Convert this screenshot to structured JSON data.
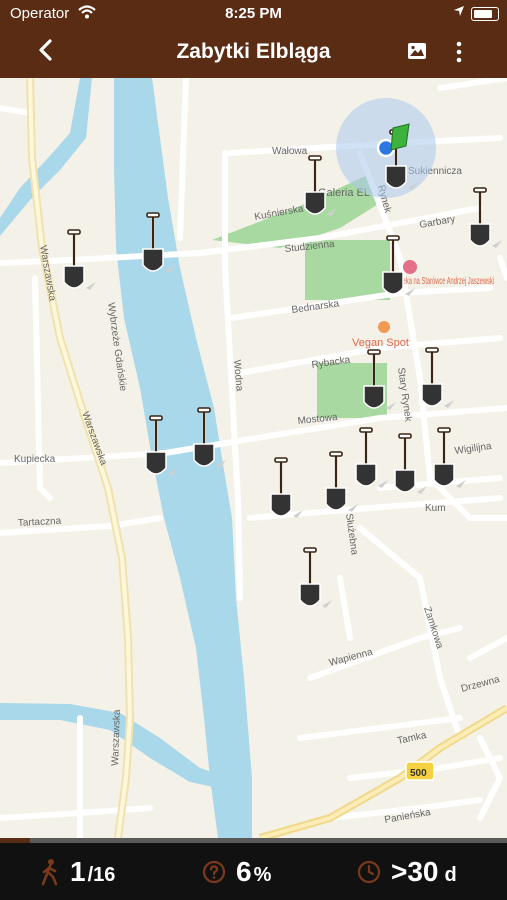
{
  "status_bar": {
    "carrier": "Operator",
    "time": "8:25 PM"
  },
  "nav": {
    "title": "Zabytki Elbląga"
  },
  "map": {
    "streets": {
      "walowa": "Wałowa",
      "sukiennicza": "Sukiennicza",
      "kusnierska": "Kuśnierska",
      "garbary": "Garbary",
      "studzienna": "Studzienna",
      "bednarska": "Bednarska",
      "rybacka": "Rybacka",
      "mostowa": "Mostowa",
      "wigilijna": "Wigilijna",
      "kupiecka": "Kupiecka",
      "tartaczna": "Tartaczna",
      "warszawska_top": "Warszawska",
      "warszawska_mid": "Warszawska",
      "warszawska_bottom": "Warszawska",
      "wybrzeze": "Wybrzeże Gdańskie",
      "wodna": "Wodna",
      "stary_rynek": "Stary Rynek",
      "rynek": "Rynek",
      "kumiecha": "Kum",
      "sluzebna": "Służebna",
      "zamkowa": "Zamkowa",
      "wapienna": "Wapienna",
      "drzewna": "Drzewna",
      "tamka": "Tamka",
      "panienska": "Panieńska",
      "road_badge": "500"
    },
    "pois": {
      "galeria": "Galeria EL",
      "apteka": "Apteka na Starówce Andrzej Jaszewski",
      "vegan": "Vegan Spot"
    },
    "marker_count": 19
  },
  "stats": {
    "visited": "1",
    "total": "/16",
    "percent": "6",
    "percent_unit": "%",
    "time": ">30",
    "time_unit": "d",
    "progress_fraction": 0.06
  },
  "colors": {
    "brand": "#5b2c14",
    "water": "#a8d8ea",
    "park": "#a8d9a0",
    "road": "#ffffff",
    "highway": "#f5d98a"
  }
}
